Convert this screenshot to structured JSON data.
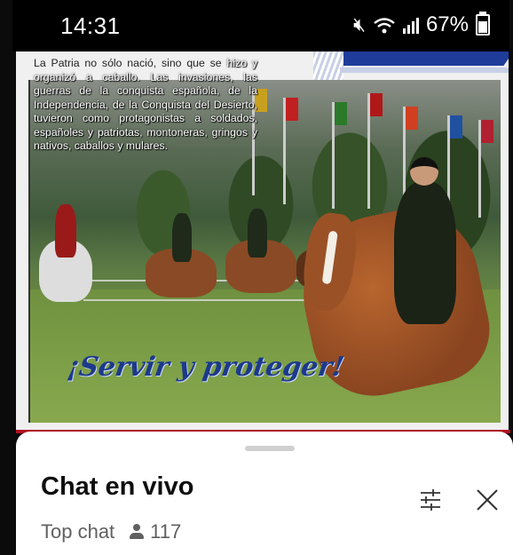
{
  "status_bar": {
    "time": "14:31",
    "battery": "67%"
  },
  "post": {
    "quote_first": "La Patria no sólo nació, sino que se",
    "quote_rest": "hizo y organizó a caballo. Las invasiones, las guerras de la conquista española, de la Independencia, de la Conquista del Desierto, tuvieron como protagonistas a soldados, españoles y patriotas, montoneras, gringos y nativos, caballos y mulares.",
    "slogan": "¡Servir y proteger!"
  },
  "chat": {
    "title": "Chat en vivo",
    "mode": "Top chat",
    "viewer_count": "117"
  },
  "colors": {
    "slogan": "#1c3a8a",
    "accent_line": "#b01020"
  }
}
